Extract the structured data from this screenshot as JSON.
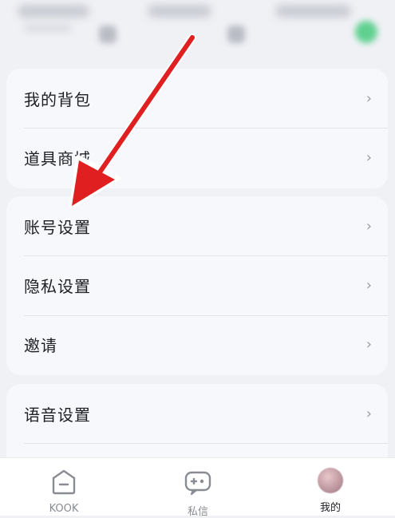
{
  "menu_groups": [
    {
      "items": [
        {
          "label": "我的背包"
        },
        {
          "label": "道具商城"
        }
      ]
    },
    {
      "items": [
        {
          "label": "账号设置"
        },
        {
          "label": "隐私设置"
        },
        {
          "label": "邀请"
        }
      ]
    },
    {
      "items": [
        {
          "label": "语音设置"
        }
      ]
    }
  ],
  "chevron_glyph": "›",
  "tabs": [
    {
      "label": "KOOK",
      "icon": "home-icon",
      "active": false
    },
    {
      "label": "私信",
      "icon": "gamepad-chat-icon",
      "active": false
    },
    {
      "label": "我的",
      "icon": "avatar",
      "active": true
    }
  ],
  "colors": {
    "background": "#f0f1f5",
    "card": "#f7f8fb",
    "text": "#1e1f24",
    "inactive_tab": "#8a8c93",
    "active_tab": "#1e1f24",
    "annotation_arrow": "#e02020"
  }
}
